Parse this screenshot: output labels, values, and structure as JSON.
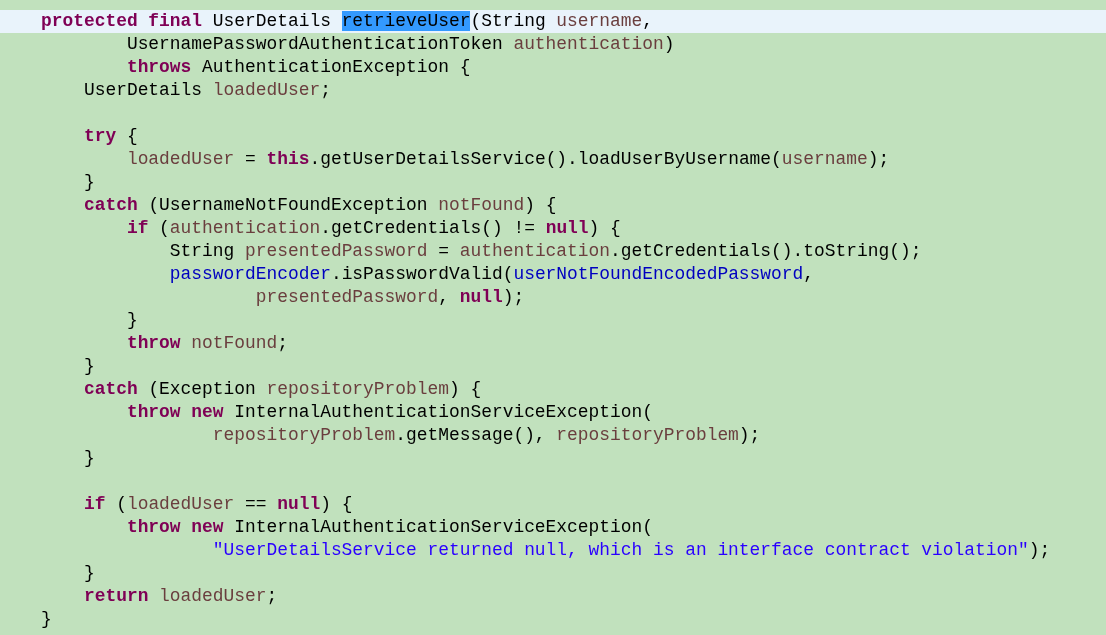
{
  "editor": {
    "lines": [
      {
        "current": true,
        "tokens": [
          {
            "kind": "keyword",
            "text": "protected final"
          },
          {
            "kind": "plain",
            "text": " UserDetails "
          },
          {
            "kind": "selected",
            "text": "retrieveUser"
          },
          {
            "kind": "plain",
            "text": "(String "
          },
          {
            "kind": "variable",
            "text": "username"
          },
          {
            "kind": "plain",
            "text": ","
          }
        ]
      },
      {
        "current": false,
        "tokens": [
          {
            "kind": "plain",
            "text": "        UsernamePasswordAuthenticationToken "
          },
          {
            "kind": "variable",
            "text": "authentication"
          },
          {
            "kind": "plain",
            "text": ")"
          }
        ]
      },
      {
        "current": false,
        "tokens": [
          {
            "kind": "keyword",
            "text": "        throws"
          },
          {
            "kind": "plain",
            "text": " AuthenticationException {"
          }
        ]
      },
      {
        "current": false,
        "tokens": [
          {
            "kind": "plain",
            "text": "    UserDetails "
          },
          {
            "kind": "variable",
            "text": "loadedUser"
          },
          {
            "kind": "plain",
            "text": ";"
          }
        ]
      },
      {
        "current": false
      },
      {
        "current": false,
        "tokens": [
          {
            "kind": "keyword",
            "text": "    try"
          },
          {
            "kind": "plain",
            "text": " {"
          }
        ]
      },
      {
        "current": false,
        "tokens": [
          {
            "kind": "variable",
            "text": "        loadedUser"
          },
          {
            "kind": "plain",
            "text": " = "
          },
          {
            "kind": "keyword",
            "text": "this"
          },
          {
            "kind": "plain",
            "text": ".getUserDetailsService().loadUserByUsername("
          },
          {
            "kind": "variable",
            "text": "username"
          },
          {
            "kind": "plain",
            "text": ");"
          }
        ]
      },
      {
        "current": false,
        "tokens": [
          {
            "kind": "plain",
            "text": "    }"
          }
        ]
      },
      {
        "current": false,
        "tokens": [
          {
            "kind": "keyword",
            "text": "    catch"
          },
          {
            "kind": "plain",
            "text": " (UsernameNotFoundException "
          },
          {
            "kind": "variable",
            "text": "notFound"
          },
          {
            "kind": "plain",
            "text": ") {"
          }
        ]
      },
      {
        "current": false,
        "tokens": [
          {
            "kind": "keyword",
            "text": "        if"
          },
          {
            "kind": "plain",
            "text": " ("
          },
          {
            "kind": "variable",
            "text": "authentication"
          },
          {
            "kind": "plain",
            "text": ".getCredentials() != "
          },
          {
            "kind": "keyword",
            "text": "null"
          },
          {
            "kind": "plain",
            "text": ") {"
          }
        ]
      },
      {
        "current": false,
        "tokens": [
          {
            "kind": "plain",
            "text": "            String "
          },
          {
            "kind": "variable",
            "text": "presentedPassword"
          },
          {
            "kind": "plain",
            "text": " = "
          },
          {
            "kind": "variable",
            "text": "authentication"
          },
          {
            "kind": "plain",
            "text": ".getCredentials().toString();"
          }
        ]
      },
      {
        "current": false,
        "tokens": [
          {
            "kind": "field",
            "text": "            passwordEncoder"
          },
          {
            "kind": "plain",
            "text": ".isPasswordValid("
          },
          {
            "kind": "field",
            "text": "userNotFoundEncodedPassword"
          },
          {
            "kind": "plain",
            "text": ","
          }
        ]
      },
      {
        "current": false,
        "tokens": [
          {
            "kind": "variable",
            "text": "                    presentedPassword"
          },
          {
            "kind": "plain",
            "text": ", "
          },
          {
            "kind": "keyword",
            "text": "null"
          },
          {
            "kind": "plain",
            "text": ");"
          }
        ]
      },
      {
        "current": false,
        "tokens": [
          {
            "kind": "plain",
            "text": "        }"
          }
        ]
      },
      {
        "current": false,
        "tokens": [
          {
            "kind": "keyword",
            "text": "        throw "
          },
          {
            "kind": "variable",
            "text": "notFound"
          },
          {
            "kind": "plain",
            "text": ";"
          }
        ]
      },
      {
        "current": false,
        "tokens": [
          {
            "kind": "plain",
            "text": "    }"
          }
        ]
      },
      {
        "current": false,
        "tokens": [
          {
            "kind": "keyword",
            "text": "    catch"
          },
          {
            "kind": "plain",
            "text": " (Exception "
          },
          {
            "kind": "variable",
            "text": "repositoryProblem"
          },
          {
            "kind": "plain",
            "text": ") {"
          }
        ]
      },
      {
        "current": false,
        "tokens": [
          {
            "kind": "keyword",
            "text": "        throw new"
          },
          {
            "kind": "plain",
            "text": " InternalAuthenticationServiceException("
          }
        ]
      },
      {
        "current": false,
        "tokens": [
          {
            "kind": "variable",
            "text": "                repositoryProblem"
          },
          {
            "kind": "plain",
            "text": ".getMessage(), "
          },
          {
            "kind": "variable",
            "text": "repositoryProblem"
          },
          {
            "kind": "plain",
            "text": ");"
          }
        ]
      },
      {
        "current": false,
        "tokens": [
          {
            "kind": "plain",
            "text": "    }"
          }
        ]
      },
      {
        "current": false
      },
      {
        "current": false,
        "tokens": [
          {
            "kind": "keyword",
            "text": "    if"
          },
          {
            "kind": "plain",
            "text": " ("
          },
          {
            "kind": "variable",
            "text": "loadedUser"
          },
          {
            "kind": "plain",
            "text": " == "
          },
          {
            "kind": "keyword",
            "text": "null"
          },
          {
            "kind": "plain",
            "text": ") {"
          }
        ]
      },
      {
        "current": false,
        "tokens": [
          {
            "kind": "keyword",
            "text": "        throw new"
          },
          {
            "kind": "plain",
            "text": " InternalAuthenticationServiceException("
          }
        ]
      },
      {
        "current": false,
        "tokens": [
          {
            "kind": "string",
            "text": "                \"UserDetailsService returned null, which is an interface contract violation\""
          },
          {
            "kind": "plain",
            "text": ");"
          }
        ]
      },
      {
        "current": false,
        "tokens": [
          {
            "kind": "plain",
            "text": "    }"
          }
        ]
      },
      {
        "current": false,
        "tokens": [
          {
            "kind": "keyword",
            "text": "    return "
          },
          {
            "kind": "variable",
            "text": "loadedUser"
          },
          {
            "kind": "plain",
            "text": ";"
          }
        ]
      },
      {
        "current": false,
        "tokens": [
          {
            "kind": "plain",
            "text": "}"
          }
        ]
      }
    ]
  }
}
